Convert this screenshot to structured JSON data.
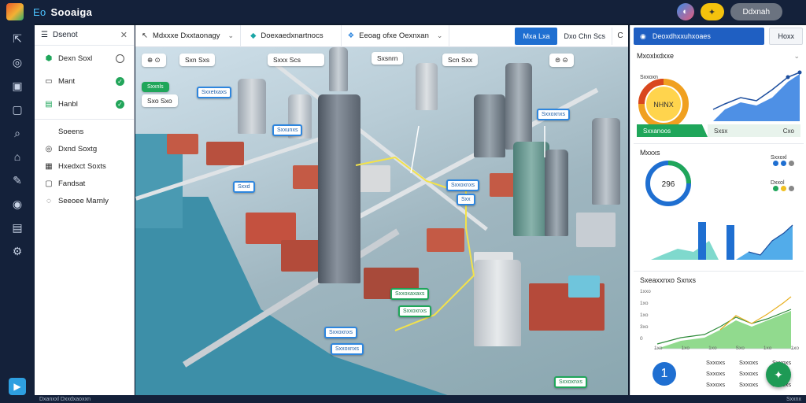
{
  "app": {
    "brand_prefix": "Eo",
    "title": "Sooaiga"
  },
  "topbar": {
    "account_button": "Ddxnah"
  },
  "side_panel": {
    "header": "Dsenot",
    "items_top": [
      {
        "label": "Dexn Soxl",
        "icon": "globe-icon",
        "check": "ring"
      },
      {
        "label": "Mant",
        "icon": "map-icon",
        "check": "done"
      },
      {
        "label": "Hanbl",
        "icon": "layers-icon",
        "check": "done"
      }
    ],
    "items_bottom": [
      {
        "label": "Soeens",
        "icon": "list-icon"
      },
      {
        "label": "Dxnd Soxtg",
        "icon": "pin-icon"
      },
      {
        "label": "Hxedxct Soxts",
        "icon": "building-icon"
      },
      {
        "label": "Fandsat",
        "icon": "folder-icon"
      },
      {
        "label": "Seeoee Marnly",
        "icon": "chat-icon"
      }
    ]
  },
  "toolbar": {
    "dropdown1": "Mdxxxe  Dxxtaonagy",
    "dropdown2": "Doexaedxnartnocs",
    "dropdown3": "Eeoag  ofxe Oexnxan",
    "primary": "Mxa  Lxa",
    "segment": "Dxo  Chn  Scs",
    "refresh": "C"
  },
  "map": {
    "chips": [
      {
        "id": "chip-zoom",
        "text": "⊕  ⊙"
      },
      {
        "id": "chip-layer",
        "text": "Sxn  Sxs"
      },
      {
        "id": "chip-filter",
        "text": "Sxxx  Scs"
      },
      {
        "id": "chip-ctrl",
        "text": "Sxsnrn"
      },
      {
        "id": "chip-mode",
        "text": "Scn  Sxx"
      },
      {
        "id": "chip-view",
        "text": "⊜  ⊝"
      },
      {
        "id": "chip-tag-title",
        "text": "Sxxnls"
      },
      {
        "id": "chip-tag-value",
        "text": "Sxo  Sxo"
      }
    ],
    "callouts": [
      "Sxxetxaxs",
      "Sxxunxs",
      "Sxxd",
      "Sxxoxnxs",
      "Sxxoxnxs",
      "Sxxoxnxs",
      "Sxxoxnxs",
      "Sxx",
      "Sxxoxaxaxs",
      "Sxxoxnxs",
      "Sxxoxnxs"
    ]
  },
  "right_panel": {
    "primary_button": "Deoxdhxxuhxoaes",
    "secondary_button": "Hoxx",
    "section1": {
      "title": "Mxoxlxdxxe",
      "gauge_label": "Sxxoxn",
      "gauge_center": "NHNX"
    },
    "progress_strip": {
      "left": "Sxxanoos",
      "mid": "Sxsx",
      "right": "Cxo"
    },
    "section2": {
      "title": "Mxxxs",
      "donut_value": "296",
      "legend1": "Sxxoxl",
      "legend2": "Dxxol"
    },
    "section3": {
      "title": "Sxeaxxnxo Sxnxs"
    },
    "line_y_ticks": [
      "1xxo",
      "1xo",
      "1xo",
      "3xo",
      "0"
    ],
    "line_x_ticks": [
      "1xo",
      "1xo",
      "1xo",
      "Sxo",
      "1xo",
      "1xo"
    ],
    "summary": {
      "count": "1",
      "rows": [
        [
          "Sxxoxs",
          "Sxxoxs",
          "Sxxoxs"
        ],
        [
          "Sxxoxs",
          "Sxxoxs",
          "Sxxoxs"
        ],
        [
          "Sxxoxs",
          "Sxxoxs",
          "Sxxoxs"
        ]
      ]
    }
  },
  "statusbar": {
    "left": "Dxanxxl  Dxxdxaoxxn",
    "right": "Sxxnx"
  },
  "colors": {
    "accent": "#1f6fd1",
    "success": "#1fa65a",
    "dark": "#14213a",
    "water": "#3d8fa8"
  }
}
